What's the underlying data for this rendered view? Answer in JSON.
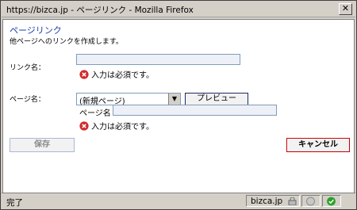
{
  "window": {
    "title": "https://bizca.jp - ページリンク - Mozilla Firefox",
    "close_glyph": "✕"
  },
  "page": {
    "heading": "ページリンク",
    "description": "他ページへのリンクを作成します。"
  },
  "link_name": {
    "label": "リンク名：",
    "value": "",
    "error": "入力は必須です。"
  },
  "page_name": {
    "label": "ページ名：",
    "select_value": "(新規ページ)",
    "preview_label": "プレビュー",
    "sub_label": "ページ名",
    "sub_value": "",
    "error": "入力は必須です。"
  },
  "actions": {
    "save_label": "保存",
    "cancel_label": "キャンセル"
  },
  "status": {
    "text": "完了",
    "domain": "bizca.jp"
  },
  "icons": {
    "error": "error-x-circle-icon",
    "dropdown": "chevron-down-icon",
    "lock": "lock-icon",
    "connection": "gray-circle-icon",
    "ok": "green-check-icon"
  },
  "colors": {
    "heading": "#1a3fa8",
    "error_icon": "#d22a2a",
    "cancel_border": "#c40000",
    "ok": "#2aa12a"
  }
}
